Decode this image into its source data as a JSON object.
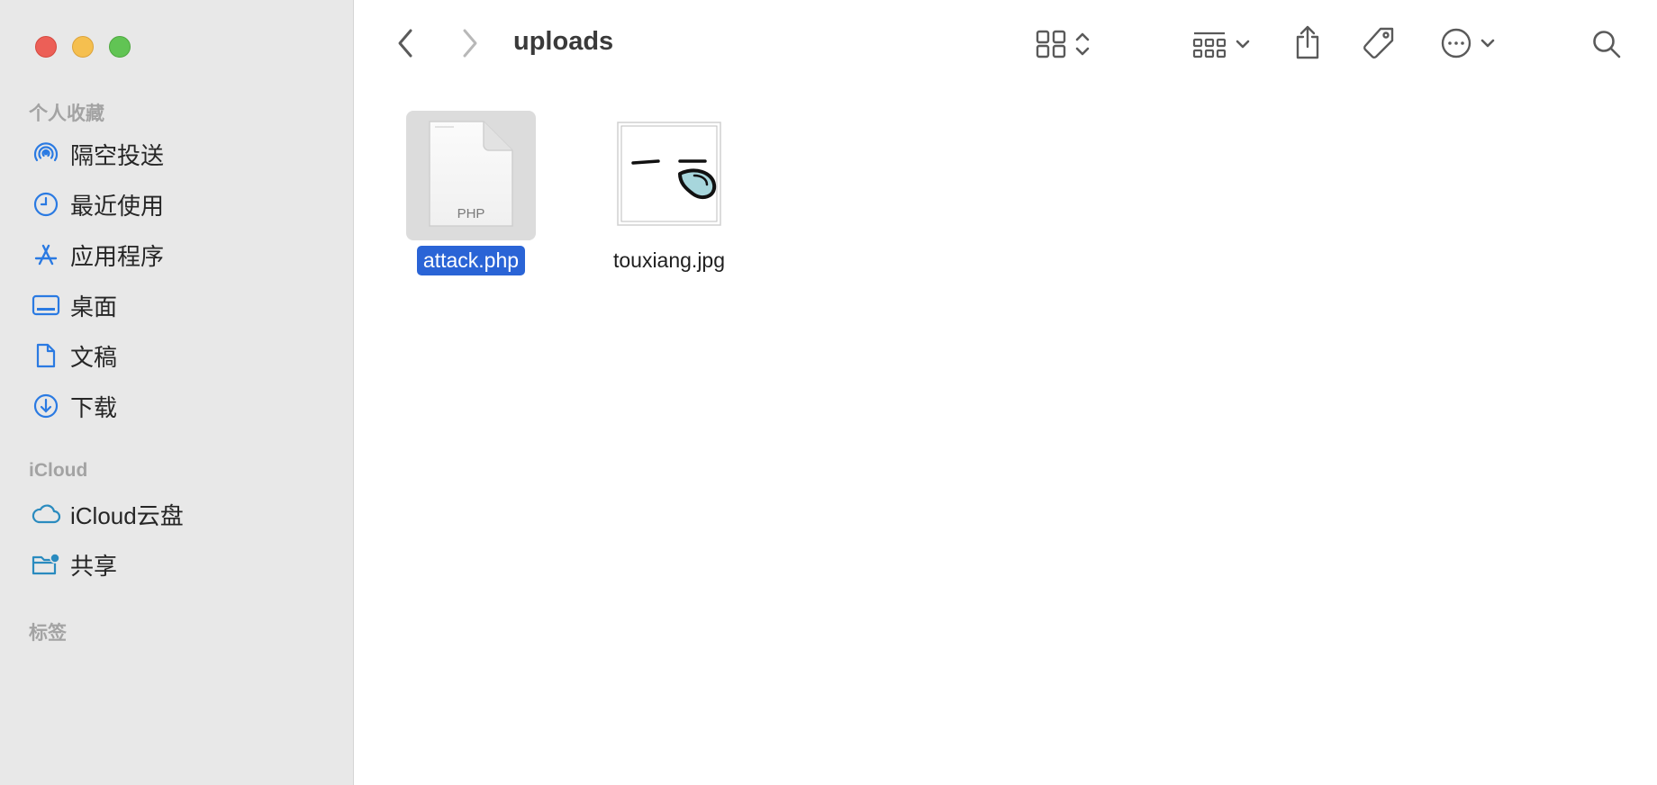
{
  "window": {
    "traffic_lights": [
      "close",
      "minimize",
      "zoom"
    ]
  },
  "sidebar": {
    "favorites_title": "个人收藏",
    "favorites": [
      {
        "label": "隔空投送",
        "icon": "airdrop-icon"
      },
      {
        "label": "最近使用",
        "icon": "clock-icon"
      },
      {
        "label": "应用程序",
        "icon": "applications-icon"
      },
      {
        "label": "桌面",
        "icon": "desktop-icon"
      },
      {
        "label": "文稿",
        "icon": "document-icon"
      },
      {
        "label": "下载",
        "icon": "download-icon"
      }
    ],
    "icloud_title": "iCloud",
    "icloud": [
      {
        "label": "iCloud云盘",
        "icon": "cloud-icon"
      },
      {
        "label": "共享",
        "icon": "shared-folder-icon"
      }
    ],
    "tags_title": "标签"
  },
  "toolbar": {
    "folder_title": "uploads"
  },
  "files": [
    {
      "name": "attack.php",
      "type_label": "PHP",
      "selected": true
    },
    {
      "name": "touxiang.jpg",
      "selected": false
    }
  ],
  "colors": {
    "accent": "#2a64d6",
    "sidebar_icon": "#2a7ae2",
    "sidebar_bg": "#e8e8e8"
  }
}
